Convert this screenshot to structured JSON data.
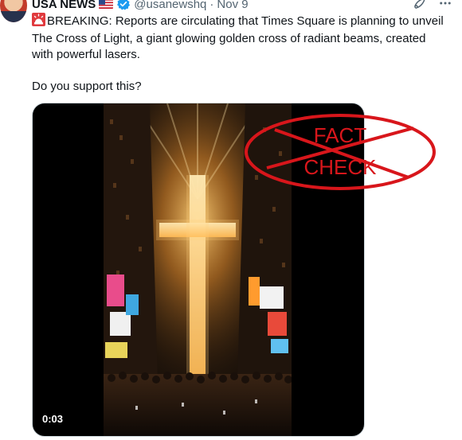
{
  "account": {
    "name": "USA NEWS",
    "handle": "@usanewshq",
    "separator": "·",
    "date": "Nov 9"
  },
  "tweet": {
    "line1": "BREAKING: Reports are circulating that Times Square is planning to unveil The Cross of Light, a giant glowing golden cross of radiant beams, created with powerful lasers.",
    "line2": "Do you support this?"
  },
  "media": {
    "timestamp": "0:03"
  },
  "overlay": {
    "line1": "FACT",
    "line2": "CHECK",
    "color": "#d8161b"
  },
  "icons": [
    "avatar",
    "us-flag-icon",
    "verified-badge-icon",
    "grok-icon",
    "more-icon",
    "siren-icon"
  ]
}
